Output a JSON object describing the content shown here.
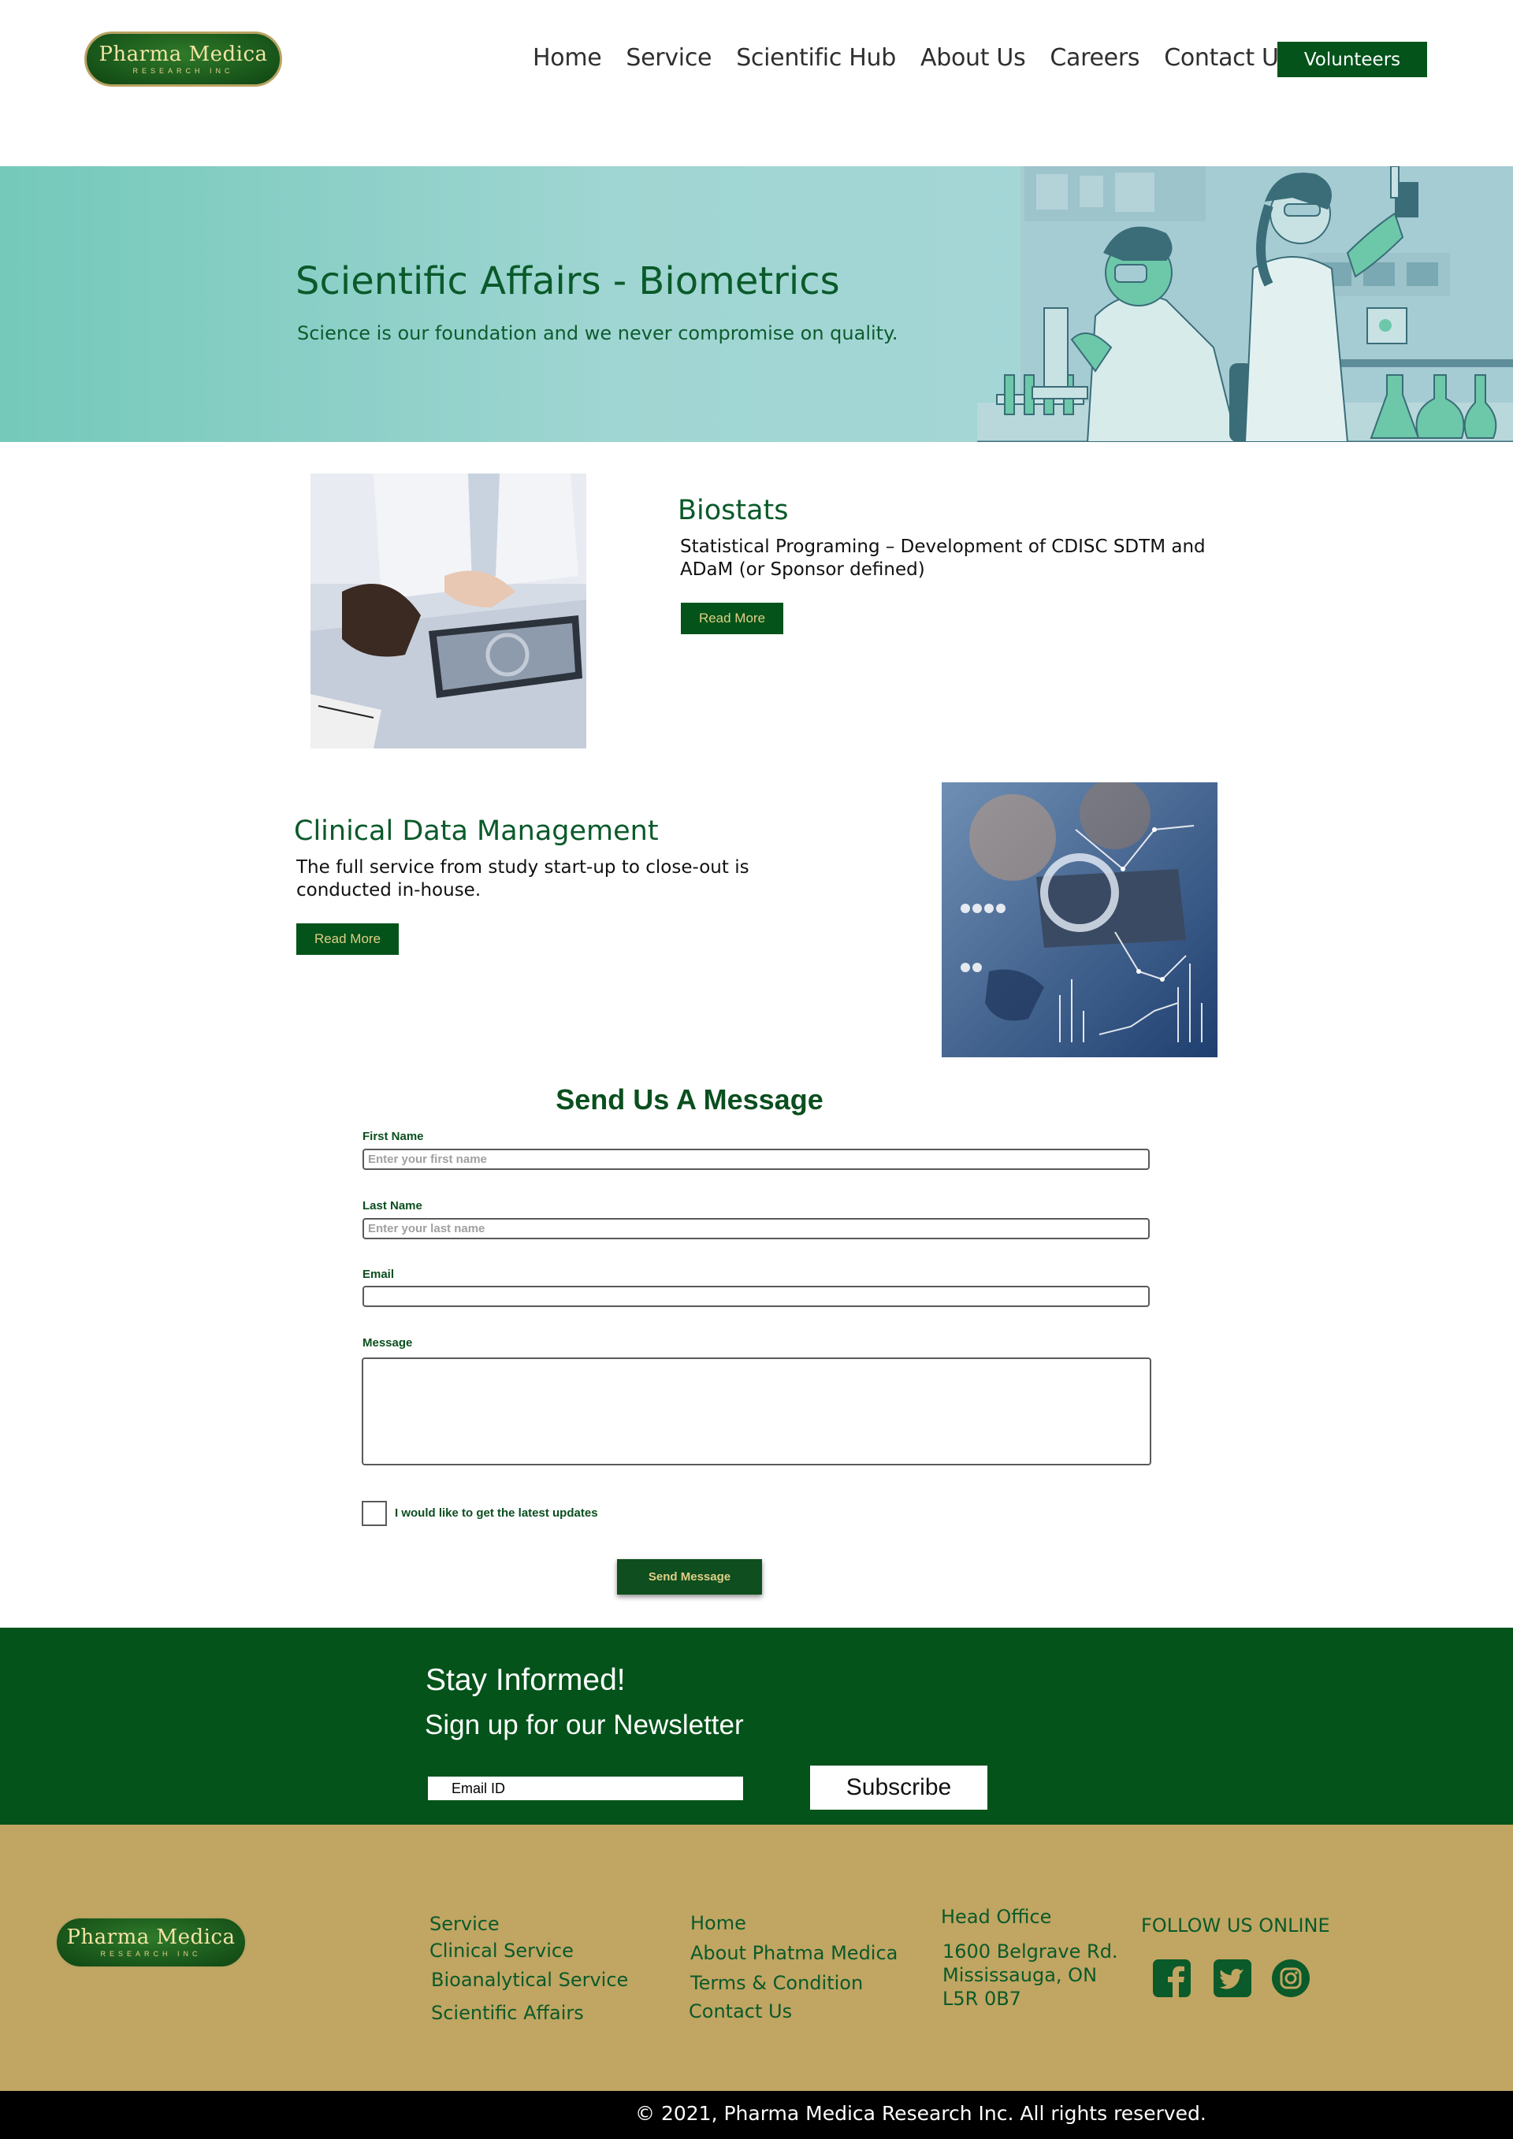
{
  "header": {
    "logo": {
      "title": "Pharma Medica",
      "subtitle": "RESEARCH INC"
    },
    "nav": [
      "Home",
      "Service",
      "Scientific Hub",
      "About Us",
      "Careers",
      "Contact Us"
    ],
    "volunteers_label": "Volunteers"
  },
  "hero": {
    "title": "Scientific Affairs - Biometrics",
    "subtitle": "Science is our foundation and we never compromise on quality."
  },
  "sections": [
    {
      "title": "Biostats",
      "description": "Statistical Programing – Development of CDISC SDTM and ADaM (or Sponsor defined)",
      "button": "Read More"
    },
    {
      "title": "Clinical Data Management",
      "description": "The full service from study start-up to close-out is conducted in-house.",
      "button": "Read More"
    }
  ],
  "form": {
    "title": "Send Us A Message",
    "first_name_label": "First Name",
    "first_name_placeholder": "Enter your first name",
    "last_name_label": "Last Name",
    "last_name_placeholder": "Enter your last name",
    "email_label": "Email",
    "message_label": "Message",
    "checkbox_label": "I would like to get the latest updates",
    "submit_label": "Send Message"
  },
  "newsletter": {
    "title": "Stay Informed!",
    "subtitle": "Sign up for our Newsletter",
    "email_placeholder": "Email ID",
    "subscribe_label": "Subscribe"
  },
  "footer": {
    "logo": {
      "title": "Pharma Medica",
      "subtitle": "RESEARCH INC"
    },
    "services": [
      "Service",
      "Clinical Service",
      "Bioanalytical Service",
      "Scientific Affairs"
    ],
    "links": [
      "Home",
      "About Phatma Medica",
      "Terms & Condition",
      "Contact Us"
    ],
    "office_heading": "Head Office",
    "address": [
      "1600 Belgrave Rd.",
      "Mississauga, ON",
      "L5R 0B7"
    ],
    "follow_label": "FOLLOW US ONLINE",
    "social": [
      "facebook-icon",
      "twitter-icon",
      "instagram-icon"
    ],
    "copyright": "© 2021, Pharma Medica Research Inc. All rights reserved."
  },
  "colors": {
    "brand_green": "#03531a",
    "footer_gold": "#c1a562",
    "hero_teal": "#9fd5d2",
    "button_text_gold": "#e0cf86"
  }
}
